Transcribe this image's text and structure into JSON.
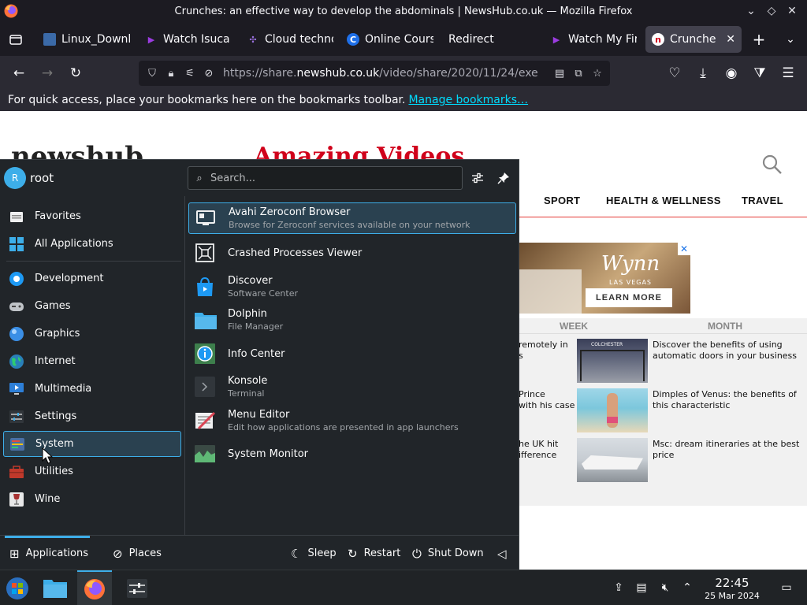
{
  "window": {
    "title": "Crunches: an effective way to develop the abdominals | NewsHub.co.uk — Mozilla Firefox"
  },
  "tabs": [
    {
      "label": "Linux_Downl",
      "icon": "linux-icon"
    },
    {
      "label": "Watch Isuca",
      "icon": "play-icon"
    },
    {
      "label": "Cloud techno",
      "icon": "cloud-icon"
    },
    {
      "label": "Online Cours",
      "icon": "c-logo-icon"
    },
    {
      "label": "Redirect",
      "icon": ""
    },
    {
      "label": "Watch My Fir",
      "icon": "play-icon"
    },
    {
      "label": "Crunches:",
      "icon": "newshub-icon",
      "active": true
    }
  ],
  "navbar": {
    "url_prefix": "https://share.",
    "url_domain": "newshub.co.uk",
    "url_path": "/video/share/2020/11/24/exe"
  },
  "bookmarks": {
    "message": "For quick access, place your bookmarks here on the bookmarks toolbar.",
    "manage_link": "Manage bookmarks…"
  },
  "page": {
    "logo_text": "newshub",
    "banner_text": "Amazing Videos",
    "nav": [
      "SPORT",
      "HEALTH & WELLNESS",
      "TRAVEL"
    ],
    "ad": {
      "brand": "Wynn",
      "sub": "LAS VEGAS",
      "cta": "LEARN MORE",
      "close": "✕"
    },
    "trending_tabs": [
      "WEEK",
      "MONTH"
    ],
    "left_fragments": [
      [
        "remotely in",
        "s"
      ],
      [
        "Prince",
        "with his case"
      ],
      [
        "he UK hit",
        "ifference"
      ]
    ],
    "stories": [
      {
        "line1": "Discover the benefits of using",
        "line2": "automatic doors in your business",
        "thumb_label": "COLCHESTER"
      },
      {
        "line1": "Dimples of Venus: the benefits of",
        "line2": "this characteristic",
        "thumb_label": ""
      },
      {
        "line1": "Msc: dream itineraries at the best",
        "line2": "price",
        "thumb_label": ""
      }
    ]
  },
  "launcher": {
    "user": {
      "name": "root",
      "initial": "R"
    },
    "search_placeholder": "Search...",
    "categories": [
      {
        "label": "Favorites",
        "icon": "favorites-icon",
        "color": "#ffffff"
      },
      {
        "label": "All Applications",
        "icon": "all-apps-icon",
        "color": "#3daee9"
      },
      {
        "label": "Development",
        "icon": "development-icon",
        "color": "#1d99f3"
      },
      {
        "label": "Games",
        "icon": "gamepad-icon",
        "color": "#c0c4c8"
      },
      {
        "label": "Graphics",
        "icon": "graphics-icon",
        "color": "#3b8fe6"
      },
      {
        "label": "Internet",
        "icon": "internet-globe-icon",
        "color": "#2ba07a"
      },
      {
        "label": "Multimedia",
        "icon": "multimedia-icon",
        "color": "#2d7fd8"
      },
      {
        "label": "Settings",
        "icon": "settings-sliders-icon",
        "color": "#5a6066"
      },
      {
        "label": "System",
        "icon": "system-icon",
        "color": "#3f8bd6",
        "selected": true
      },
      {
        "label": "Utilities",
        "icon": "utilities-toolbox-icon",
        "color": "#c0392b"
      },
      {
        "label": "Wine",
        "icon": "wine-glass-icon",
        "color": "#a83232"
      }
    ],
    "apps": [
      {
        "name": "Avahi Zeroconf Browser",
        "desc": "Browse for Zeroconf services available on your network",
        "icon": "network-monitor-icon",
        "selected": true
      },
      {
        "name": "Crashed Processes Viewer",
        "desc": "",
        "icon": "crash-viewer-icon"
      },
      {
        "name": "Discover",
        "desc": "Software Center",
        "icon": "discover-bag-icon"
      },
      {
        "name": "Dolphin",
        "desc": "File Manager",
        "icon": "dolphin-folder-icon"
      },
      {
        "name": "Info Center",
        "desc": "",
        "icon": "info-center-icon"
      },
      {
        "name": "Konsole",
        "desc": "Terminal",
        "icon": "konsole-terminal-icon"
      },
      {
        "name": "Menu Editor",
        "desc": "Edit how applications are presented in app launchers",
        "icon": "menu-editor-icon"
      },
      {
        "name": "System Monitor",
        "desc": "",
        "icon": "system-monitor-icon"
      }
    ],
    "footer": {
      "applications": "Applications",
      "places": "Places",
      "sleep": "Sleep",
      "restart": "Restart",
      "shutdown": "Shut Down"
    }
  },
  "taskbar": {
    "time": "22:45",
    "date": "25 Mar 2024"
  },
  "colors": {
    "accent": "#3daee9",
    "selection_bg": "#2a4150",
    "launcher_bg": "#212529",
    "link": "#00ddff"
  }
}
